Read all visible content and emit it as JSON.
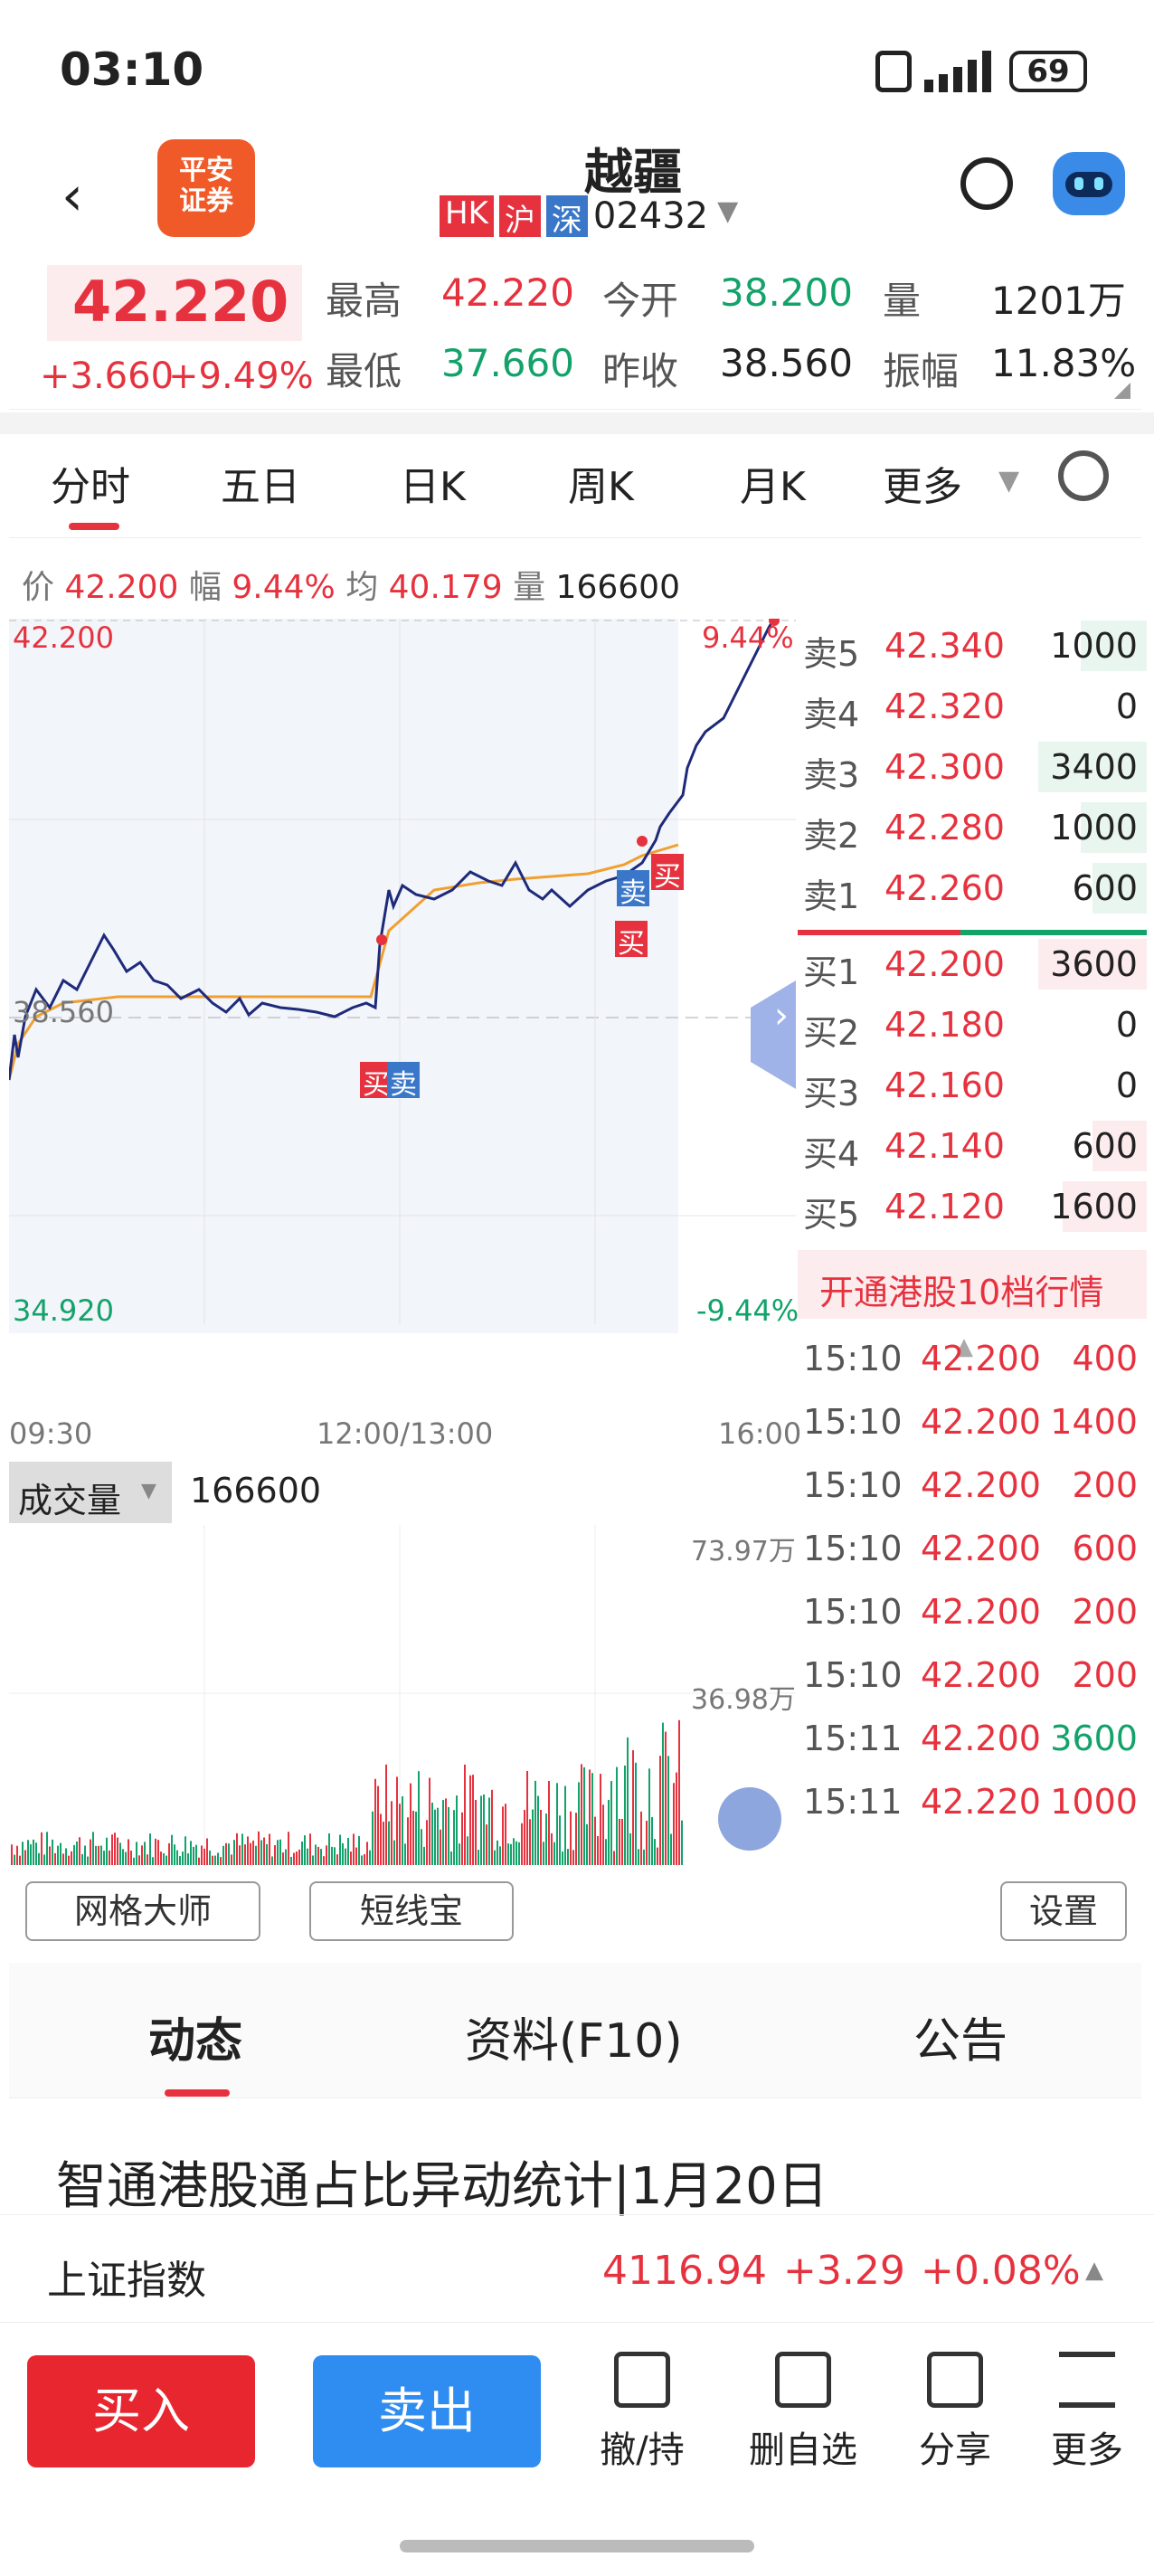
{
  "status": {
    "time": "03:10",
    "battery": "69"
  },
  "header": {
    "logo_text": "平安\n证券",
    "title": "越疆",
    "tags": [
      "HK",
      "沪",
      "深"
    ],
    "code": "02432"
  },
  "quote": {
    "price": "42.220",
    "change": "+3.660",
    "pct": "+9.49%",
    "high_label": "最高",
    "high": "42.220",
    "open_label": "今开",
    "open": "38.200",
    "vol_label": "量",
    "vol": "1201万",
    "low_label": "最低",
    "low": "37.660",
    "prev_label": "昨收",
    "prev": "38.560",
    "amp_label": "振幅",
    "amp": "11.83%"
  },
  "tabs": [
    "分时",
    "五日",
    "日K",
    "周K",
    "月K",
    "更多"
  ],
  "chart": {
    "info_price_label": "价",
    "info_price": "42.200",
    "info_pct_label": "幅",
    "info_pct": "9.44%",
    "info_avg_label": "均",
    "info_avg": "40.179",
    "info_vol_label": "量",
    "info_vol": "166600",
    "y_top": "42.200",
    "y_mid": "38.560",
    "y_bot": "34.920",
    "pct_top": "9.44%",
    "pct_bot": "-9.44%",
    "x_start": "09:30",
    "x_mid": "12:00/13:00",
    "x_end": "16:00",
    "vol_label": "成交量",
    "vol_value": "166600",
    "vol_top": "73.97万",
    "vol_mid": "36.98万",
    "marker_buy": "买",
    "marker_sell": "卖"
  },
  "orderbook": {
    "asks": [
      {
        "label": "卖5",
        "price": "42.340",
        "qty": "1000"
      },
      {
        "label": "卖4",
        "price": "42.320",
        "qty": "0"
      },
      {
        "label": "卖3",
        "price": "42.300",
        "qty": "3400"
      },
      {
        "label": "卖2",
        "price": "42.280",
        "qty": "1000"
      },
      {
        "label": "卖1",
        "price": "42.260",
        "qty": "600"
      }
    ],
    "bids": [
      {
        "label": "买1",
        "price": "42.200",
        "qty": "3600"
      },
      {
        "label": "买2",
        "price": "42.180",
        "qty": "0"
      },
      {
        "label": "买3",
        "price": "42.160",
        "qty": "0"
      },
      {
        "label": "买4",
        "price": "42.140",
        "qty": "600"
      },
      {
        "label": "买5",
        "price": "42.120",
        "qty": "1600"
      }
    ],
    "link": "开通港股10档行情"
  },
  "ticks": [
    {
      "t": "15:10",
      "p": "42.200",
      "q": "400"
    },
    {
      "t": "15:10",
      "p": "42.200",
      "q": "1400"
    },
    {
      "t": "15:10",
      "p": "42.200",
      "q": "200"
    },
    {
      "t": "15:10",
      "p": "42.200",
      "q": "600"
    },
    {
      "t": "15:10",
      "p": "42.200",
      "q": "200"
    },
    {
      "t": "15:10",
      "p": "42.200",
      "q": "200"
    },
    {
      "t": "15:11",
      "p": "42.200",
      "q": "3600"
    },
    {
      "t": "15:11",
      "p": "42.220",
      "q": "1000"
    }
  ],
  "tools": {
    "grid": "网格大师",
    "short": "短线宝",
    "settings": "设置"
  },
  "sections": [
    "动态",
    "资料(F10)",
    "公告"
  ],
  "news": {
    "headline": "智通港股通占比异动统计|1月20日"
  },
  "index": {
    "name": "上证指数",
    "value": "4116.94",
    "change": "+3.29",
    "pct": "+0.08%"
  },
  "bottom": {
    "buy": "买入",
    "sell": "卖出",
    "cancel": "撤/持",
    "remove": "删自选",
    "share": "分享",
    "more": "更多"
  },
  "colors": {
    "up": "#e6323e",
    "down": "#13a26a",
    "buy_btn": "#e8262f",
    "sell_btn": "#2f8cf0",
    "line": "#1e2a7a",
    "avg": "#f0a030"
  }
}
